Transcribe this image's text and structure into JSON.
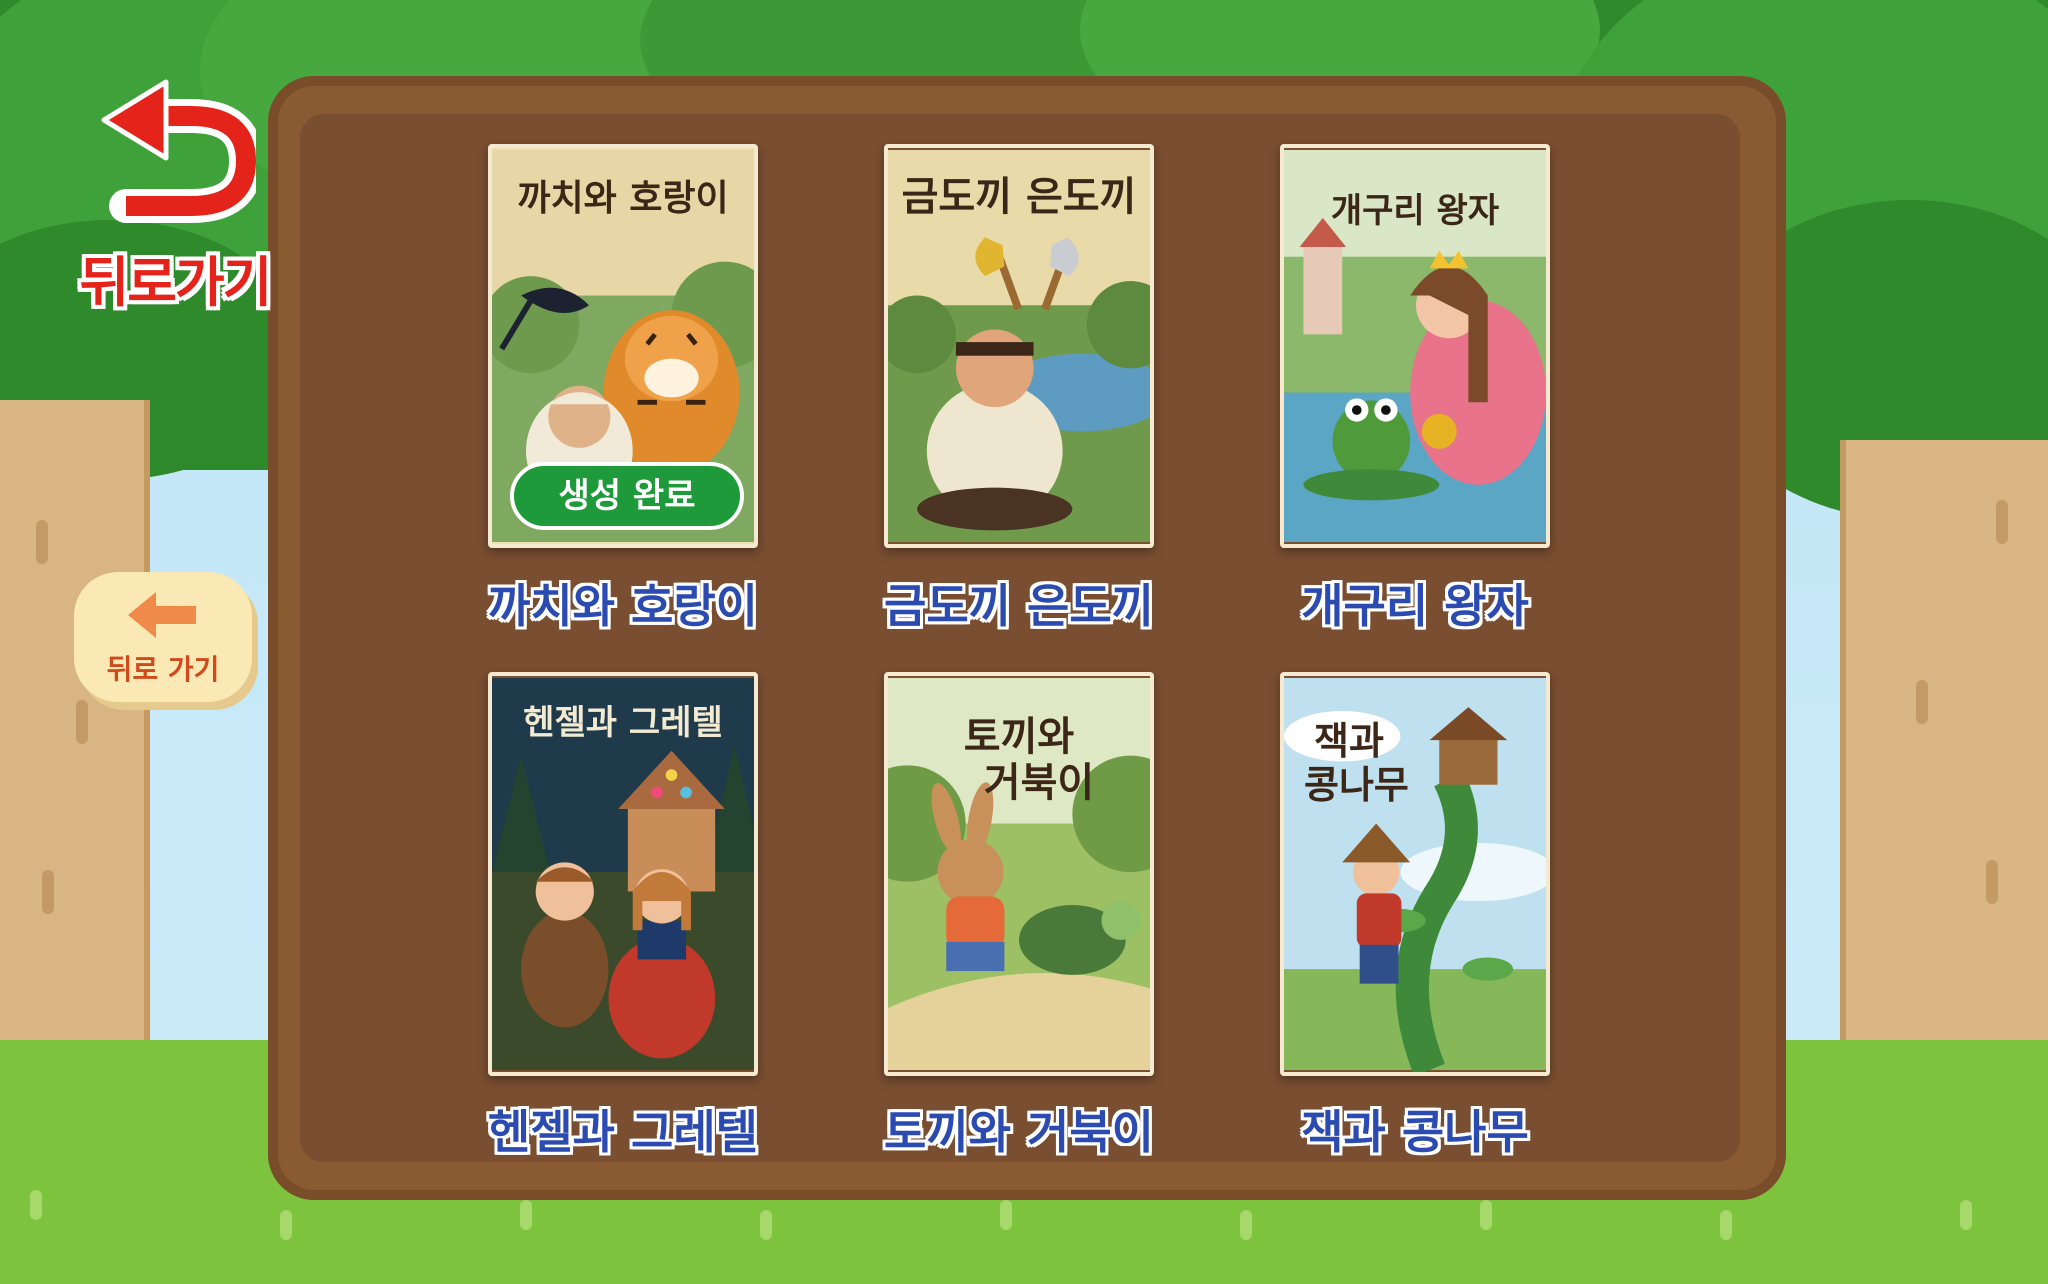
{
  "header": {
    "back_label": "뒤로가기"
  },
  "side": {
    "back_label": "뒤로 가기"
  },
  "stories": [
    {
      "cover_title": "까치와 호랑이",
      "caption": "까치와 호랑이",
      "badge": "생성 완료"
    },
    {
      "cover_title": "금도끼 은도끼",
      "caption": "금도끼 은도끼"
    },
    {
      "cover_title": "개구리 왕자",
      "caption": "개구리 왕자"
    },
    {
      "cover_title": "헨젤과 그레텔",
      "caption": "헨젤과 그레텔"
    },
    {
      "cover_title_line1": "토끼와",
      "cover_title_line2": "거북이",
      "caption": "토끼와 거북이"
    },
    {
      "cover_title_line1": "잭과",
      "cover_title_line2": "콩나무",
      "caption": "잭과 콩나무"
    }
  ],
  "colors": {
    "caption": "#2b4bb0",
    "back_red": "#e4241b",
    "badge_green": "#1f9a3a",
    "board": "#7a4e31"
  }
}
